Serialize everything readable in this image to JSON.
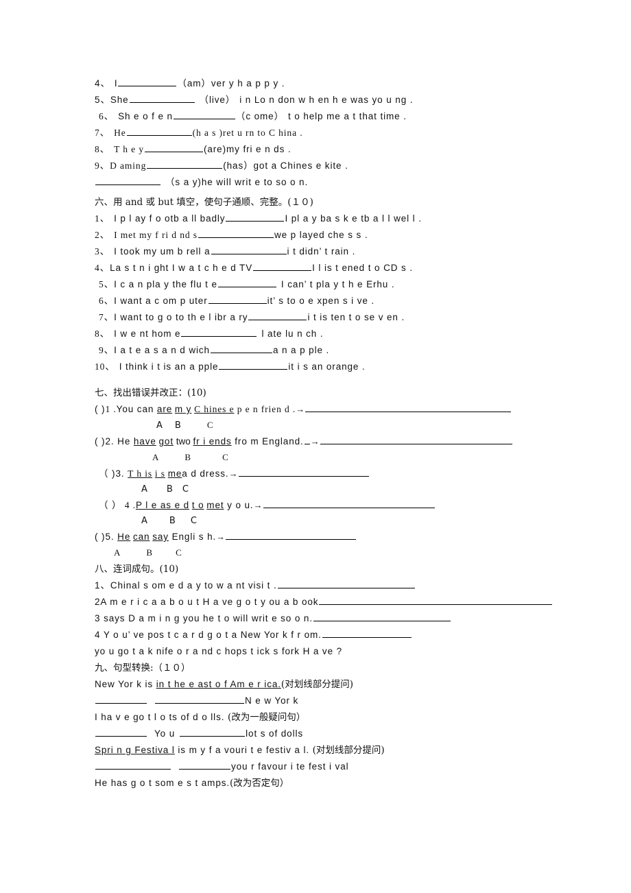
{
  "document": {
    "type": "english-exam-worksheet-scan",
    "page_background": "#ffffff",
    "text_color": "#000000"
  },
  "section_five_continued": {
    "items": [
      {
        "num": "4、",
        "text_before": "I",
        "paren": "（am）",
        "text_after": "ver y   h a p p y   ."
      },
      {
        "num": "5、",
        "text_before": "She",
        "paren": "（live）",
        "text_after": "i n   Lo n don   w h en    h e was yo u ng ."
      },
      {
        "num": "6、",
        "text_before": "Sh e    o f e n",
        "paren": "（c ome）",
        "text_after": "t o   help me  a t that time   ."
      },
      {
        "num": "7、",
        "text_before": "He",
        "paren": "(h a s )",
        "text_after": "ret u rn   to  C hina ."
      },
      {
        "num": "8、",
        "text_before": "T h e y",
        "paren": "(are)",
        "text_after": "my fri e n ds ."
      },
      {
        "num": "9、",
        "text_before": "D aming",
        "paren": "(has）",
        "text_after": "got a   Chines e   kite ."
      },
      {
        "num": "",
        "text_before": "",
        "paren": "（s a y)",
        "text_after": "he will writ e   to so o n."
      }
    ]
  },
  "section_six": {
    "heading": "六、用 and 或 but 填空，使句子通顺、完整。(１０)",
    "items": [
      {
        "num": "1、",
        "left": "I p l ay f o otb a ll badly",
        "right": "I pl a y ba s k e tb a l l   wel l  ."
      },
      {
        "num": "2、",
        "left": "I   met my   f ri d nd s",
        "right": "we   p layed che s  s  ."
      },
      {
        "num": "3、",
        "left": "I   took my um b rell a",
        "right": "i t   didn’ t  rain ."
      },
      {
        "num": "4、",
        "left": "La s t n i  ght   I   w a t c h e d   TV",
        "right": "I  l is t ened t o  CD s   ."
      },
      {
        "num": "5、",
        "left": "I  c a n pla y   the flu t e",
        "right": "I can’ t pla y   t h e Erhu ."
      },
      {
        "num": "6、",
        "left": "I want a  c om p uter",
        "right": "it’ s   to o   e xpen s  i ve ."
      },
      {
        "num": "7、",
        "left": "I want  to  g o   to th e    l ibr a ry",
        "right": "i t is ten t o   se v en ."
      },
      {
        "num": "8、",
        "left": "I  w e nt hom e",
        "right": "l ate lu n ch   ."
      },
      {
        "num": "9、",
        "left": "I   a t e  a   s a n d wich",
        "right": "a n a p ple   ."
      },
      {
        "num": "10、",
        "left": "I think i t   is an  a pple",
        "right": "it   i s an orange  ."
      }
    ]
  },
  "section_seven": {
    "heading": "七、找出错误并改正：(10)",
    "items": [
      {
        "bracket": "(   )",
        "num": "1 .",
        "before": "You    can ",
        "a": "are",
        "mid1": " ",
        "b": "m y",
        "mid2": "  ",
        "c": "C hines e",
        "after": "  p  e n frien d .",
        "arrow": "→",
        "labels": [
          "A",
          "B",
          "C"
        ]
      },
      {
        "bracket": "(   )",
        "num": "2.",
        "before": " He ",
        "a": "have",
        "mid1": " ",
        "b": "got",
        "mid2": "   two ",
        "c": "fr i ends",
        "after": " fro m   England.",
        "arrow": "→",
        "labels": [
          "A",
          "B",
          "C"
        ]
      },
      {
        "bracket": "（   )",
        "num": "3.",
        "before": " ",
        "a": "T h is",
        "mid1": " ",
        "b": "i s",
        "mid2": "  ",
        "c": "me",
        "after": "a d dress.",
        "arrow": "→",
        "labels": [
          "A",
          "B",
          "C"
        ]
      },
      {
        "bracket": "（  ）",
        "num": " 4 .",
        "before": "",
        "a": "P l  e as e d",
        "mid1": "  ",
        "b": "t o",
        "mid2": " ",
        "c": "met",
        "after": "  y o u.",
        "arrow": "→",
        "labels": [
          "A",
          "B",
          "C"
        ]
      },
      {
        "bracket": "(  )",
        "num": "5.",
        "before": " ",
        "a": "He",
        "mid1": "   ",
        "b": "can",
        "mid2": " ",
        "c": "say",
        "after": " Engli s h.",
        "arrow": "→",
        "labels": [
          "A",
          "B",
          "C"
        ]
      }
    ]
  },
  "section_eight": {
    "heading": "八、连词成句。(10)",
    "items": [
      {
        "num": "1、",
        "text": "Chinal  s om e d a y  to   w a nt visi t  ."
      },
      {
        "num": "2",
        "text": "A m e r i c a   a b o u t   H a ve   g o t  y ou  a  b ook"
      },
      {
        "num": "3",
        "text": " says D a m i n g you he t o   will writ e   so o n."
      },
      {
        "num": "4",
        "text": " Y o u’ ve   pos t c a r d   g o t  a   New Yor k  f r om."
      },
      {
        "num": "",
        "text": "yo u    go t    a  k nife    o  r    a nd    c hops t ick s    fork  H a ve ?"
      }
    ]
  },
  "section_nine": {
    "heading": "九、句型转换:（１０）",
    "items": [
      {
        "prompt_plain_before": "New Yor k   is ",
        "prompt_underlined": "in   t he    e ast o f    Am e  r ica.",
        "prompt_note": "(对划线部分提问)",
        "answer_tail": "N e w Yor k"
      },
      {
        "prompt_plain_before": "I ha v e go t   l o ts   of  d o lls. ",
        "prompt_underlined": "",
        "prompt_note": "(改为一般疑问句）",
        "answer_mid": "Yo u",
        "answer_tail": "lot s    of   dolls"
      },
      {
        "prompt_plain_before": "",
        "prompt_underlined": "Spri n  g    Festiva l",
        "prompt_plain_after": "  is   m y  f a vouri t e festiv a l.  ",
        "prompt_note": "(对划线部分提问)",
        "answer_tail": "you r   favour i te fest i val"
      },
      {
        "prompt_plain_before": "He has  g o t  som e   s t amps.",
        "prompt_note": "(改为否定句）"
      }
    ]
  }
}
